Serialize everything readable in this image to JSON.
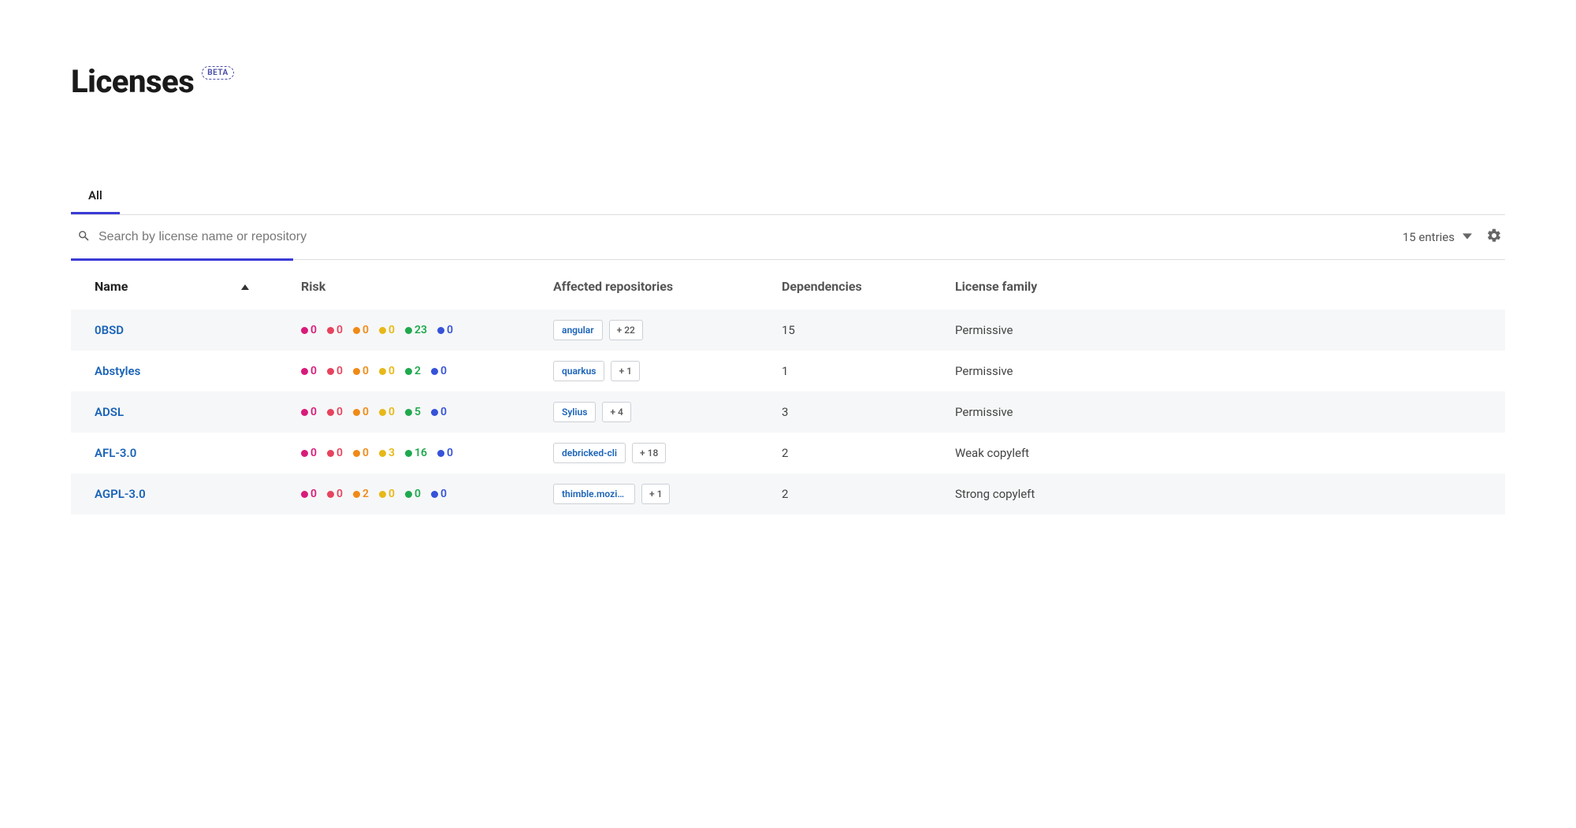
{
  "header": {
    "title": "Licenses",
    "beta_badge": "BETA"
  },
  "tabs": {
    "all": "All"
  },
  "search": {
    "placeholder": "Search by license name or repository"
  },
  "entries": {
    "label": "15 entries"
  },
  "columns": {
    "name": "Name",
    "risk": "Risk",
    "repos": "Affected repositories",
    "deps": "Dependencies",
    "family": "License family"
  },
  "risk_colors": [
    "magenta",
    "red",
    "orange",
    "yellow",
    "green",
    "blue"
  ],
  "rows": [
    {
      "name": "0BSD",
      "risk": [
        0,
        0,
        0,
        0,
        23,
        0
      ],
      "repo_main": "angular",
      "repo_more": "+ 22",
      "deps": "15",
      "family": "Permissive"
    },
    {
      "name": "Abstyles",
      "risk": [
        0,
        0,
        0,
        0,
        2,
        0
      ],
      "repo_main": "quarkus",
      "repo_more": "+ 1",
      "deps": "1",
      "family": "Permissive"
    },
    {
      "name": "ADSL",
      "risk": [
        0,
        0,
        0,
        0,
        5,
        0
      ],
      "repo_main": "Sylius",
      "repo_more": "+ 4",
      "deps": "3",
      "family": "Permissive"
    },
    {
      "name": "AFL-3.0",
      "risk": [
        0,
        0,
        0,
        3,
        16,
        0
      ],
      "repo_main": "debricked-cli",
      "repo_more": "+ 18",
      "deps": "2",
      "family": "Weak copyleft"
    },
    {
      "name": "AGPL-3.0",
      "risk": [
        0,
        0,
        2,
        0,
        0,
        0
      ],
      "repo_main": "thimble.mozill...",
      "repo_more": "+ 1",
      "deps": "2",
      "family": "Strong copyleft"
    }
  ]
}
